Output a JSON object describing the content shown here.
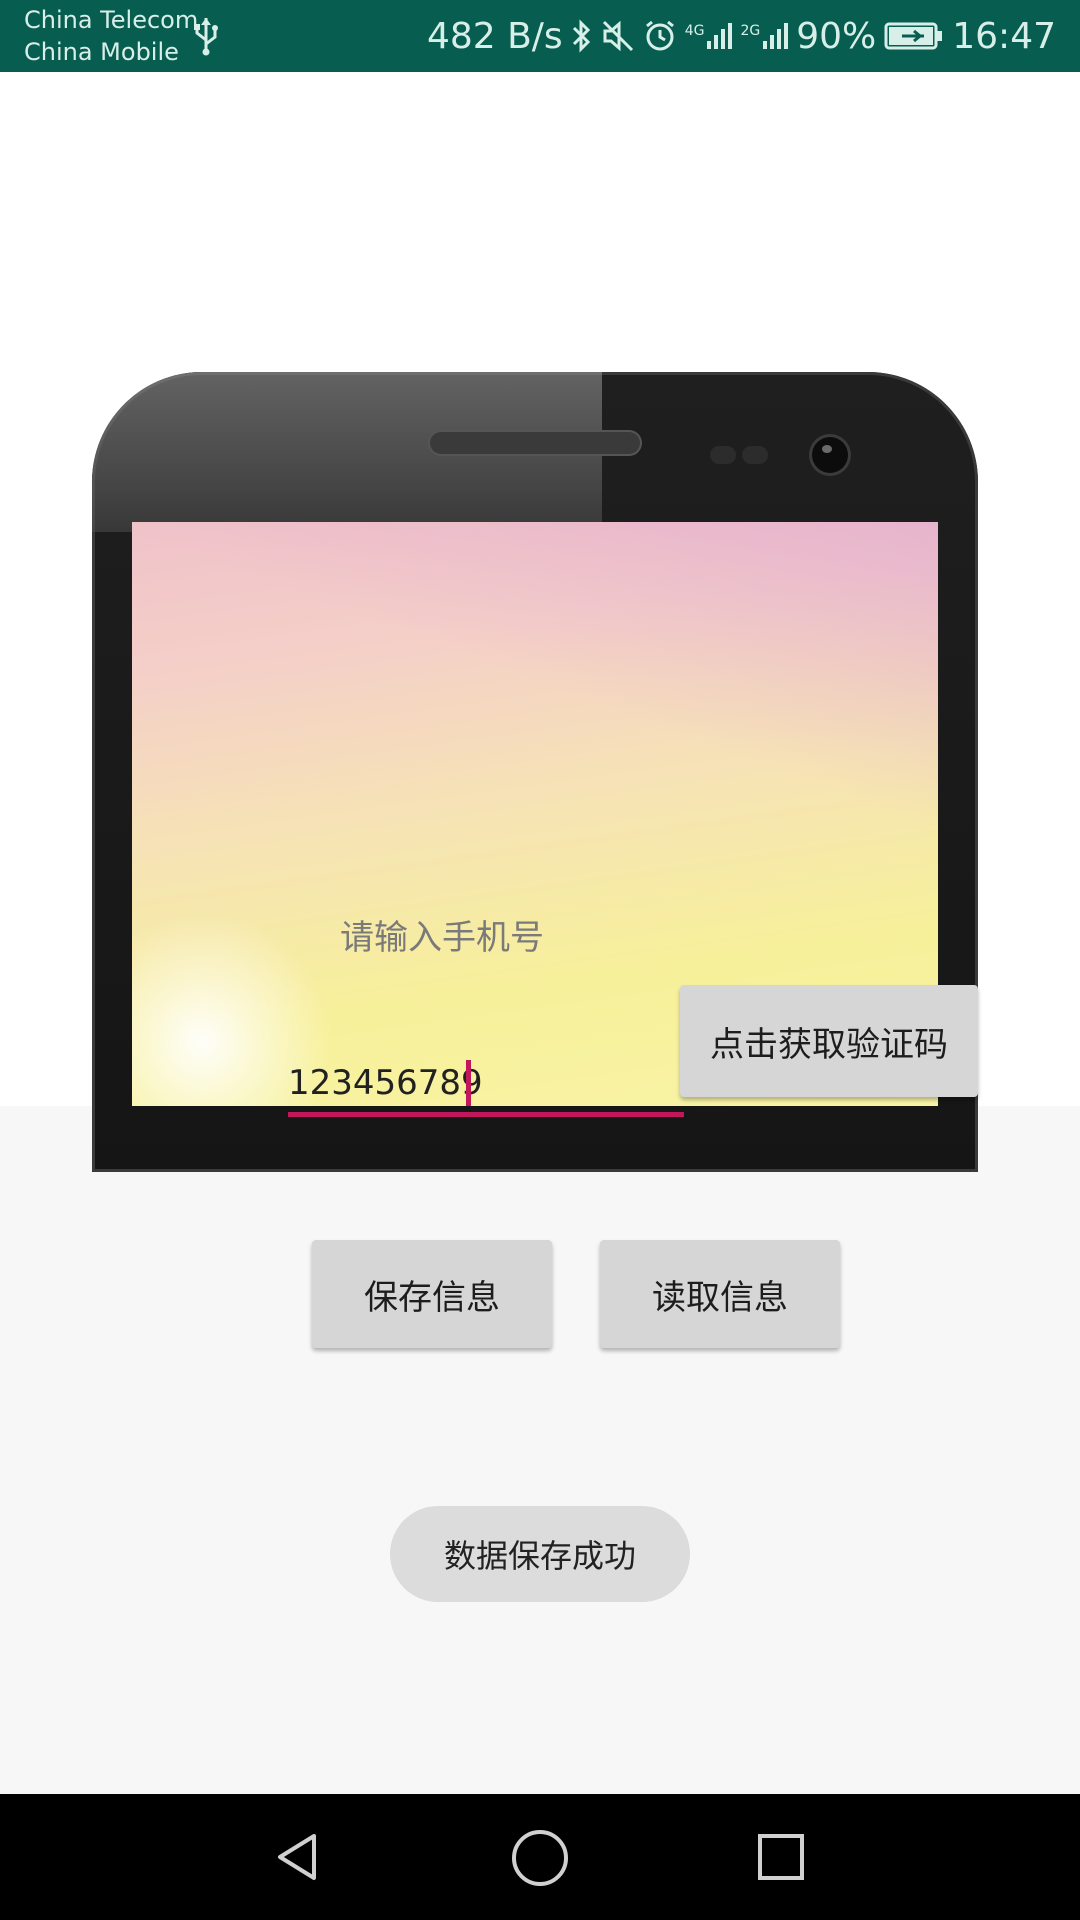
{
  "status_bar": {
    "carrier_1": "China Telecom",
    "carrier_2": "China Mobile",
    "net_speed": "482 B/s",
    "network_1": "4G",
    "network_2": "2G",
    "battery_percent": "90%",
    "time": "16:47",
    "icons": [
      "usb-icon",
      "bluetooth-icon",
      "mute-icon",
      "alarm-icon",
      "signal-4g-icon",
      "signal-2g-icon",
      "battery-charging-icon"
    ]
  },
  "form": {
    "phone_hint": "请输入手机号",
    "phone_value": "123456789",
    "get_code_label": "点击获取验证码",
    "save_label": "保存信息",
    "read_label": "读取信息"
  },
  "toast": {
    "message": "数据保存成功"
  },
  "nav": {
    "icons": [
      "back-icon",
      "home-icon",
      "recent-apps-icon"
    ]
  },
  "colors": {
    "status_bar": "#075e50",
    "accent": "#c2185b",
    "button": "#d6d6d6",
    "background": "#f7f7f7"
  }
}
